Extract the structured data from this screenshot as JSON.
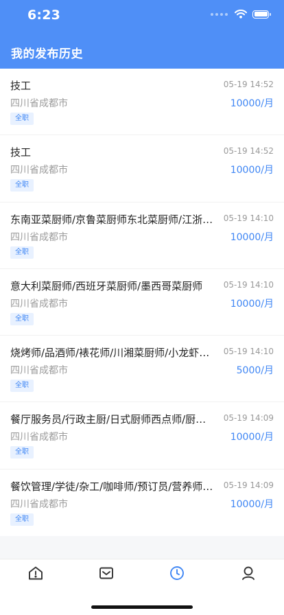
{
  "status_bar": {
    "time": "6:23"
  },
  "header": {
    "title": "我的发布历史"
  },
  "posts": [
    {
      "title": "技工",
      "time": "05-19 14:52",
      "location": "四川省成都市",
      "salary": "10000/月",
      "tag": "全职"
    },
    {
      "title": "技工",
      "time": "05-19 14:52",
      "location": "四川省成都市",
      "salary": "10000/月",
      "tag": "全职"
    },
    {
      "title": "东南亚菜厨师/京鲁菜厨师东北菜厨师/江浙菜厨师",
      "time": "05-19 14:10",
      "location": "四川省成都市",
      "salary": "10000/月",
      "tag": "全职"
    },
    {
      "title": "意大利菜厨师/西班牙菜厨师/墨西哥菜厨师",
      "time": "05-19 14:10",
      "location": "四川省成都市",
      "salary": "10000/月",
      "tag": "全职"
    },
    {
      "title": "烧烤师/品酒师/裱花师/川湘菜厨师/小龙虾厨师",
      "time": "05-19 14:10",
      "location": "四川省成都市",
      "salary": "5000/月",
      "tag": "全职"
    },
    {
      "title": "餐厅服务员/行政主厨/日式厨师西点师/厨师长",
      "time": "05-19 14:09",
      "location": "四川省成都市",
      "salary": "10000/月",
      "tag": "全职"
    },
    {
      "title": "餐饮管理/学徒/杂工/咖啡师/预订员/营养师/面点师",
      "time": "05-19 14:09",
      "location": "四川省成都市",
      "salary": "10000/月",
      "tag": "全职"
    }
  ],
  "tabbar": {
    "items": [
      {
        "icon": "home-alert-icon",
        "active": false
      },
      {
        "icon": "mail-icon",
        "active": false
      },
      {
        "icon": "clock-icon",
        "active": true
      },
      {
        "icon": "user-icon",
        "active": false
      }
    ],
    "active_color": "#3f86f4",
    "inactive_color": "#333333"
  },
  "colors": {
    "header_bg": "#4f8ff7",
    "accent": "#3f86f4",
    "tag_bg": "#e8f1ff"
  }
}
